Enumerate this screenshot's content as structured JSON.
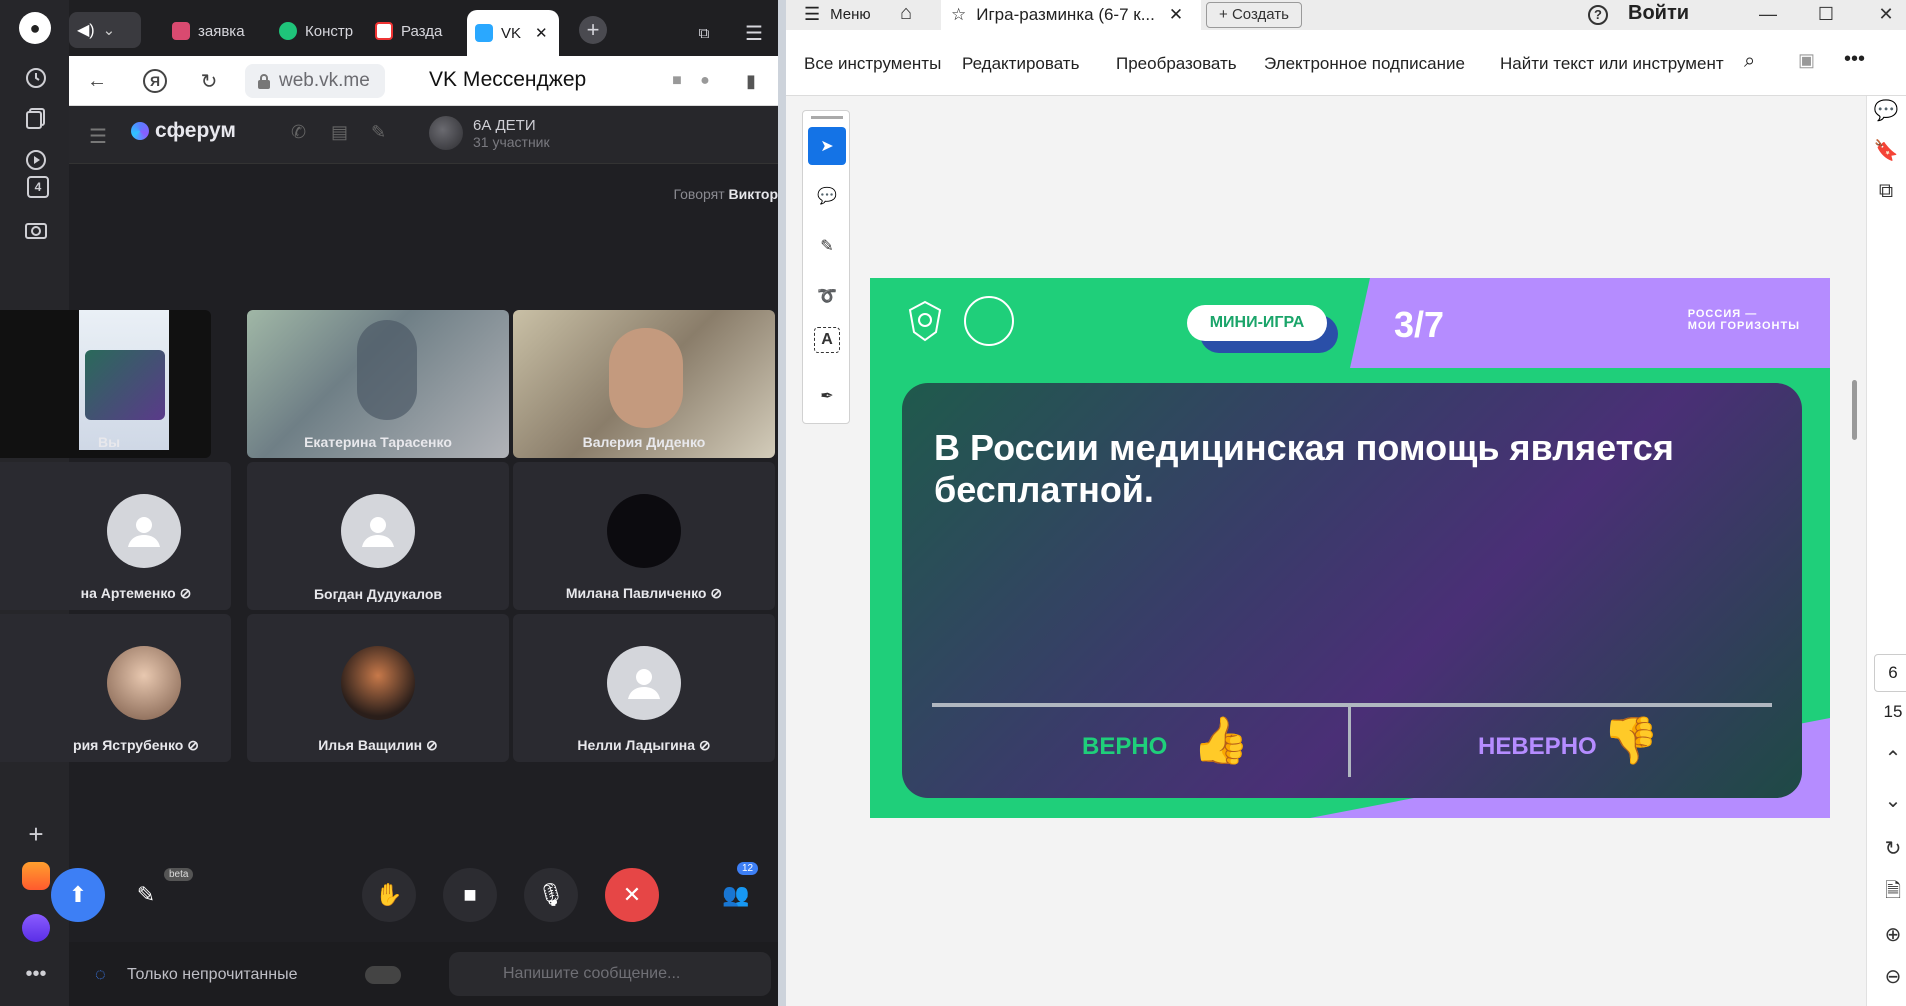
{
  "left_browser": {
    "tabs": [
      {
        "label": "заявка"
      },
      {
        "label": "Констр"
      },
      {
        "label": "Разда"
      },
      {
        "label": "VK"
      }
    ],
    "address": {
      "url": "web.vk.me",
      "title": "VK Мессенджер"
    },
    "vk": {
      "brand": "сферум",
      "chat_name": "6А ДЕТИ",
      "chat_members": "31 участник",
      "speaking_prefix": "Говорят",
      "speaking_name": "Виктор",
      "participants": [
        {
          "name": "Вы",
          "type": "screen"
        },
        {
          "name": "Екатерина Тарасенко",
          "type": "video"
        },
        {
          "name": "Валерия Диденко",
          "type": "video"
        },
        {
          "name": "на Артеменко",
          "type": "avatar"
        },
        {
          "name": "Богдан Дудукалов",
          "type": "avatar"
        },
        {
          "name": "Милана Павличенко",
          "type": "dark"
        },
        {
          "name": "рия Яструбенко",
          "type": "photo"
        },
        {
          "name": "Илья Ващилин",
          "type": "photo2"
        },
        {
          "name": "Нелли Ладыгина",
          "type": "avatar"
        }
      ],
      "beta_label": "beta",
      "participants_badge": "12",
      "unread_label": "Только непрочитанные",
      "message_placeholder": "Напишите сообщение..."
    },
    "side_number": "4"
  },
  "reader": {
    "menu_label": "Меню",
    "doc_tab": "Игра-разминка (6-7 к...",
    "create_label": "Создать",
    "login_label": "Войти",
    "tools": [
      "Все инструменты",
      "Редактировать",
      "Преобразовать",
      "Электронное подписание",
      "Найти текст или инструмент"
    ],
    "page_current": "6",
    "page_total": "15",
    "slide": {
      "pill": "МИНИ-ИГРА",
      "counter": "3/7",
      "brand_line1": "РОССИЯ —",
      "brand_line2": "МОИ ГОРИЗОНТЫ",
      "question": "В России медицинская помощь является бесплатной.",
      "true_label": "ВЕРНО",
      "false_label": "НЕВЕРНО"
    }
  },
  "colors": {
    "slide_green": "#1fcf7a",
    "slide_purple": "#b58cff",
    "hangup_red": "#e64646",
    "acrobat_blue": "#1473e6"
  }
}
